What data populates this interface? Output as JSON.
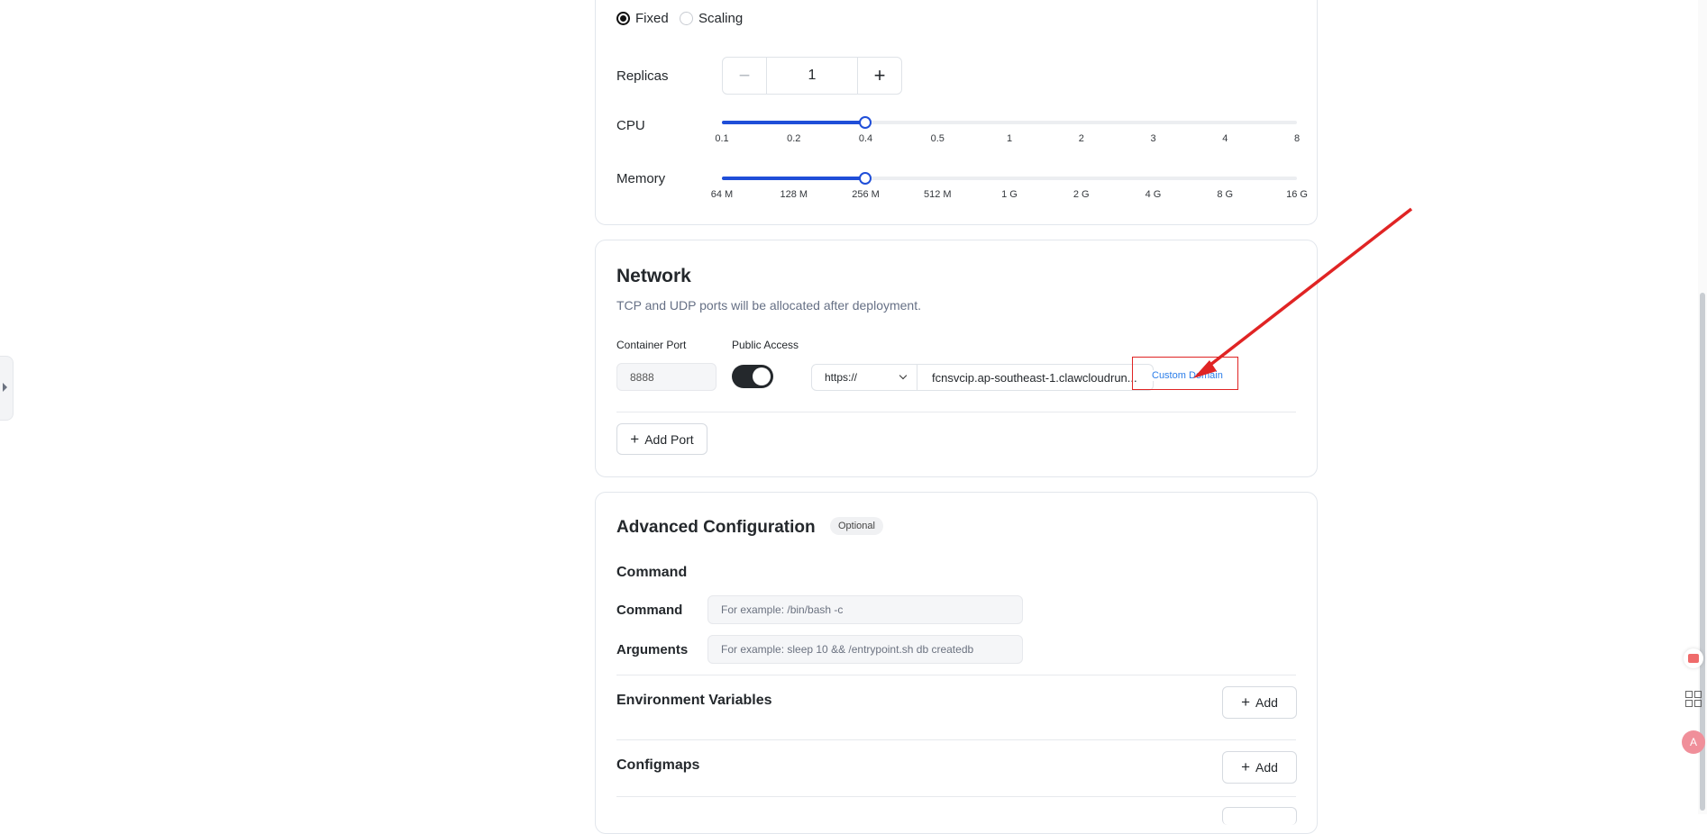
{
  "deploy_mode": {
    "fixed_label": "Fixed",
    "scaling_label": "Scaling",
    "selected": "Fixed"
  },
  "replicas": {
    "label": "Replicas",
    "value": "1",
    "minus": "−",
    "plus": "+"
  },
  "cpu": {
    "label": "CPU",
    "ticks": [
      "0.1",
      "0.2",
      "0.4",
      "0.5",
      "1",
      "2",
      "3",
      "4",
      "8"
    ],
    "selected": "0.4"
  },
  "memory": {
    "label": "Memory",
    "ticks": [
      "64 M",
      "128 M",
      "256 M",
      "512 M",
      "1 G",
      "2 G",
      "4 G",
      "8 G",
      "16 G"
    ],
    "selected": "256 M"
  },
  "network": {
    "title": "Network",
    "description": "TCP and UDP ports will be allocated after deployment.",
    "container_port_label": "Container Port",
    "public_access_label": "Public Access",
    "port_value": "8888",
    "protocol": "https://",
    "domain": "fcnsvcip.ap-southeast-1.clawcloudrun...",
    "custom_domain": "Custom Domain",
    "add_port": "Add Port",
    "public_access_on": true
  },
  "advanced": {
    "title": "Advanced Configuration",
    "badge": "Optional",
    "command_section": "Command",
    "command_label": "Command",
    "command_placeholder": "For example:  /bin/bash -c",
    "arguments_label": "Arguments",
    "arguments_placeholder": "For example:  sleep 10 && /entrypoint.sh db createdb",
    "env_label": "Environment Variables",
    "configmaps_label": "Configmaps",
    "add_label": "Add"
  },
  "colors": {
    "accent": "#1f4ed8",
    "annotation": "#e02424",
    "link": "#2b7de9"
  }
}
